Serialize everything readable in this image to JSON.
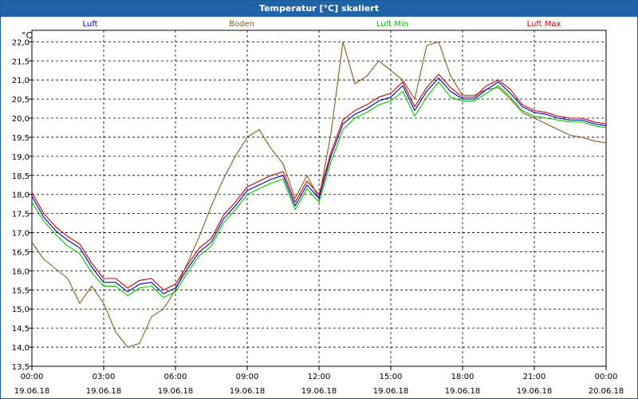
{
  "window": {
    "title": "Temperatur [°C] skaliert"
  },
  "chart_data": {
    "type": "line",
    "title": "Temperatur [°C] skaliert",
    "ylabel": "°C",
    "xlabel": "",
    "ylim": [
      13.5,
      22.3
    ],
    "xlim": [
      0,
      24
    ],
    "grid": true,
    "legend": "top",
    "y_ticks": [
      "13,5",
      "14,0",
      "14,5",
      "15,0",
      "15,5",
      "16,0",
      "16,5",
      "17,0",
      "17,5",
      "18,0",
      "18,5",
      "19,0",
      "19,5",
      "20,0",
      "20,5",
      "21,0",
      "21,5",
      "22,0"
    ],
    "x_ticks": [
      {
        "time": "00:00",
        "date": "19.06.18"
      },
      {
        "time": "03:00",
        "date": "19.06.18"
      },
      {
        "time": "06:00",
        "date": "19.06.18"
      },
      {
        "time": "09:00",
        "date": "19.06.18"
      },
      {
        "time": "12:00",
        "date": "19.06.18"
      },
      {
        "time": "15:00",
        "date": "19.06.18"
      },
      {
        "time": "18:00",
        "date": "19.06.18"
      },
      {
        "time": "21:00",
        "date": "19.06.18"
      },
      {
        "time": "00:00",
        "date": "20.06.18"
      }
    ],
    "series": [
      {
        "name": "Luft",
        "color": "#0000cc",
        "x": [
          0,
          0.5,
          1,
          1.5,
          2,
          2.5,
          3,
          3.5,
          4,
          4.5,
          5,
          5.5,
          6,
          6.5,
          7,
          7.5,
          8,
          8.5,
          9,
          9.5,
          10,
          10.5,
          11,
          11.5,
          12,
          12.5,
          13,
          13.5,
          14,
          14.5,
          15,
          15.5,
          16,
          16.5,
          17,
          17.5,
          18,
          18.5,
          19,
          19.5,
          20,
          20.5,
          21,
          21.5,
          22,
          22.5,
          23,
          23.5,
          24
        ],
        "values": [
          17.95,
          17.4,
          17.05,
          16.8,
          16.6,
          16.1,
          15.7,
          15.7,
          15.45,
          15.65,
          15.7,
          15.4,
          15.55,
          16.05,
          16.5,
          16.75,
          17.35,
          17.7,
          18.1,
          18.25,
          18.4,
          18.5,
          17.7,
          18.25,
          17.9,
          19.0,
          19.85,
          20.1,
          20.25,
          20.45,
          20.55,
          20.85,
          20.2,
          20.7,
          21.05,
          20.7,
          20.5,
          20.5,
          20.75,
          20.95,
          20.65,
          20.3,
          20.15,
          20.1,
          20.0,
          19.95,
          19.95,
          19.85,
          19.8
        ]
      },
      {
        "name": "Boden",
        "color": "#8b5a1b",
        "x": [
          0,
          0.5,
          1,
          1.5,
          2,
          2.5,
          3,
          3.5,
          4,
          4.5,
          5,
          5.5,
          6,
          6.5,
          7,
          7.5,
          8,
          8.5,
          9,
          9.5,
          10,
          10.5,
          11,
          11.5,
          12,
          12.5,
          13,
          13.5,
          14,
          14.5,
          15,
          15.5,
          16,
          16.5,
          17,
          17.5,
          18,
          18.5,
          19,
          19.5,
          20,
          20.5,
          21,
          21.5,
          22,
          22.5,
          23,
          23.5,
          24
        ],
        "values": [
          16.75,
          16.3,
          16.05,
          15.8,
          15.15,
          15.6,
          15.15,
          14.4,
          14.0,
          14.1,
          14.8,
          15.0,
          15.5,
          16.2,
          16.9,
          17.7,
          18.4,
          19.0,
          19.5,
          19.7,
          19.2,
          18.8,
          17.9,
          18.5,
          17.9,
          19.6,
          22.0,
          20.9,
          21.1,
          21.5,
          21.25,
          21.0,
          20.5,
          21.9,
          22.0,
          21.1,
          20.6,
          20.6,
          20.75,
          20.8,
          20.5,
          20.15,
          20.0,
          19.85,
          19.7,
          19.55,
          19.5,
          19.4,
          19.35
        ]
      },
      {
        "name": "Luft Min",
        "color": "#00cc00",
        "x": [
          0,
          0.5,
          1,
          1.5,
          2,
          2.5,
          3,
          3.5,
          4,
          4.5,
          5,
          5.5,
          6,
          6.5,
          7,
          7.5,
          8,
          8.5,
          9,
          9.5,
          10,
          10.5,
          11,
          11.5,
          12,
          12.5,
          13,
          13.5,
          14,
          14.5,
          15,
          15.5,
          16,
          16.5,
          17,
          17.5,
          18,
          18.5,
          19,
          19.5,
          20,
          20.5,
          21,
          21.5,
          22,
          22.5,
          23,
          23.5,
          24
        ],
        "values": [
          17.8,
          17.3,
          16.95,
          16.65,
          16.45,
          15.95,
          15.6,
          15.6,
          15.35,
          15.55,
          15.6,
          15.3,
          15.45,
          15.95,
          16.4,
          16.65,
          17.25,
          17.6,
          18.0,
          18.15,
          18.3,
          18.4,
          17.6,
          18.15,
          17.8,
          18.85,
          19.7,
          20.0,
          20.15,
          20.35,
          20.45,
          20.7,
          20.05,
          20.55,
          20.95,
          20.55,
          20.45,
          20.45,
          20.65,
          20.85,
          20.55,
          20.2,
          20.05,
          20.0,
          19.95,
          19.9,
          19.9,
          19.8,
          19.75
        ]
      },
      {
        "name": "Luft Max",
        "color": "#cc0000",
        "x": [
          0,
          0.5,
          1,
          1.5,
          2,
          2.5,
          3,
          3.5,
          4,
          4.5,
          5,
          5.5,
          6,
          6.5,
          7,
          7.5,
          8,
          8.5,
          9,
          9.5,
          10,
          10.5,
          11,
          11.5,
          12,
          12.5,
          13,
          13.5,
          14,
          14.5,
          15,
          15.5,
          16,
          16.5,
          17,
          17.5,
          18,
          18.5,
          19,
          19.5,
          20,
          20.5,
          21,
          21.5,
          22,
          22.5,
          23,
          23.5,
          24
        ],
        "values": [
          18.05,
          17.5,
          17.15,
          16.9,
          16.7,
          16.2,
          15.8,
          15.8,
          15.55,
          15.75,
          15.8,
          15.5,
          15.65,
          16.15,
          16.6,
          16.85,
          17.45,
          17.8,
          18.2,
          18.35,
          18.5,
          18.6,
          17.8,
          18.35,
          18.0,
          19.1,
          19.95,
          20.2,
          20.35,
          20.55,
          20.65,
          20.95,
          20.3,
          20.8,
          21.15,
          20.8,
          20.55,
          20.55,
          20.85,
          21.0,
          20.75,
          20.35,
          20.2,
          20.15,
          20.05,
          20.0,
          20.0,
          19.9,
          19.85
        ]
      }
    ]
  }
}
